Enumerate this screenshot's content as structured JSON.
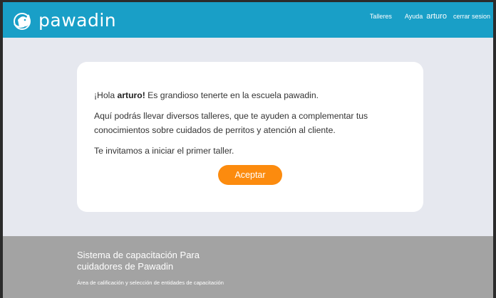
{
  "header": {
    "brand": "pawadin",
    "logo_icon": "pawadin-dog-logo",
    "background_color": "#199fc7",
    "nav": {
      "talleres": "Talleres",
      "ayuda": "Ayuda",
      "user": "arturo",
      "logout": "cerrar sesion"
    }
  },
  "welcome": {
    "greeting_prefix": "¡Hola ",
    "user_name": "arturo!",
    "greeting_suffix": " Es grandioso tenerte en la escuela pawadin.",
    "paragraph_2": "Aquí podrás llevar diversos talleres, que te ayuden a complementar tus conocimientos sobre cuidados de perritos y atención al cliente.",
    "paragraph_3": "Te invitamos a iniciar el primer taller.",
    "accept_button": "Aceptar",
    "accent_color": "#fc8b0e"
  },
  "footer": {
    "title": "Sistema de capacitación Para cuidadores de Pawadin",
    "subtitle": "Área de calificación y selección de entidades de capacitación",
    "background_color": "#a3a3a3"
  }
}
